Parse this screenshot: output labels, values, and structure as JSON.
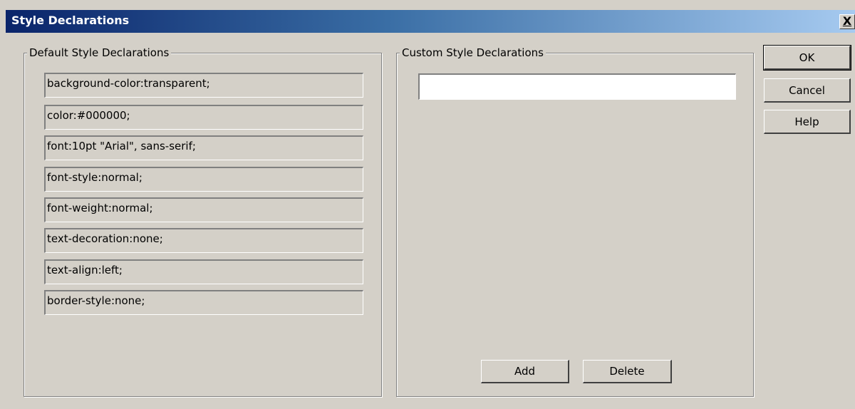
{
  "window": {
    "title": "Style Declarations",
    "close_label": "X"
  },
  "default_group": {
    "legend": "Default Style Declarations",
    "items": [
      "background-color:transparent;",
      "color:#000000;",
      "font:10pt \"Arial\", sans-serif;",
      "font-style:normal;",
      "font-weight:normal;",
      "text-decoration:none;",
      "text-align:left;",
      "border-style:none;"
    ]
  },
  "custom_group": {
    "legend": "Custom Style Declarations",
    "input_value": "",
    "add_label": "Add",
    "delete_label": "Delete"
  },
  "buttons": {
    "ok_label": "OK",
    "cancel_label": "Cancel",
    "help_label": "Help"
  }
}
